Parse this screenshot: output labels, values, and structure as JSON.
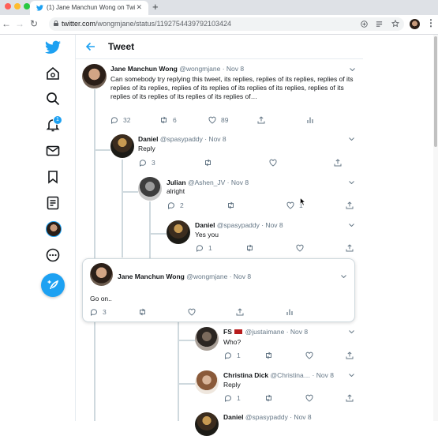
{
  "browser": {
    "tab_title": "(1) Jane Manchun Wong on Twi…",
    "url_host": "twitter.com",
    "url_path": "/wongmjane/status/1192754439792103424"
  },
  "header": {
    "title": "Tweet"
  },
  "sidebar": {
    "notification_count": "1"
  },
  "tweets": {
    "main": {
      "name": "Jane Manchun Wong",
      "handle": "@wongmjane · Nov 8",
      "text": "Can somebody try replying this tweet, its replies, replies of its replies, replies of its replies of its replies, replies of its replies of its replies of its replies, replies of its replies of its replies of its replies of its replies of…",
      "replies": "32",
      "retweets": "6",
      "likes": "89"
    },
    "daniel1": {
      "name": "Daniel",
      "handle": "@spasypaddy · Nov 8",
      "text": "Reply",
      "replies": "3"
    },
    "julian": {
      "name": "Julian",
      "handle": "@Ashen_JV · Nov 8",
      "text": "alright",
      "replies": "2",
      "likes": "1"
    },
    "daniel2": {
      "name": "Daniel",
      "handle": "@spasypaddy · Nov 8",
      "text": "Yes you",
      "replies": "1"
    },
    "focused": {
      "name": "Jane Manchun Wong",
      "handle": "@wongmjane · Nov 8",
      "text": "Go on..",
      "replies": "3"
    },
    "fs": {
      "name": "FS",
      "handle": "@justaimane · Nov 8",
      "text": "Who?",
      "replies": "1"
    },
    "christina": {
      "name": "Christina Dick",
      "handle": "@Christina… · Nov 8",
      "text": "Reply",
      "replies": "1"
    },
    "daniel3": {
      "name": "Daniel",
      "handle": "@spasypaddy · Nov 8"
    }
  },
  "colors": {
    "brand": "#1da1f2",
    "notification_badge": "#1da1f2"
  }
}
